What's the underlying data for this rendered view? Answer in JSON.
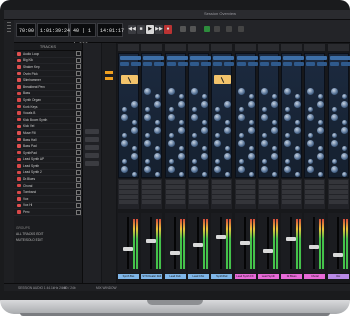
{
  "window": {
    "title": "Session Overview"
  },
  "transport": {
    "counter1": "70:00",
    "counter2": "1:01:39:24",
    "counter3": "40 | 1 | 282",
    "counter4": "14:01:17"
  },
  "sidebar": {
    "header": "TRACKS",
    "tracks": [
      {
        "name": "Audio Loop",
        "color": "#e05050"
      },
      {
        "name": "Big Kik",
        "color": "#e05050"
      },
      {
        "name": "Shaker Kep",
        "color": "#e05050"
      },
      {
        "name": "Ovrtn Pick",
        "color": "#e05050"
      },
      {
        "name": "Slimhammer",
        "color": "#e05050"
      },
      {
        "name": "Breakbeat Perc",
        "color": "#e05050"
      },
      {
        "name": "Bass",
        "color": "#d84848"
      },
      {
        "name": "Synth Organ",
        "color": "#d84848"
      },
      {
        "name": "Kork Keys",
        "color": "#d84848"
      },
      {
        "name": "Vocals B",
        "color": "#d84848"
      },
      {
        "name": "Kick Boom Synth",
        "color": "#d84848"
      },
      {
        "name": "Kick Vel",
        "color": "#e05050"
      },
      {
        "name": "Muse Fill",
        "color": "#e05050"
      },
      {
        "name": "Bass Hall",
        "color": "#e05050"
      },
      {
        "name": "Bass Pad",
        "color": "#e05050"
      },
      {
        "name": "SynthPad",
        "color": "#d84848"
      },
      {
        "name": "Lead Synth AP",
        "color": "#d84848"
      },
      {
        "name": "Lead Synth",
        "color": "#d84848"
      },
      {
        "name": "Lead Synth 2",
        "color": "#d84848"
      },
      {
        "name": "Dr.Blues",
        "color": "#d84848"
      },
      {
        "name": "Choral",
        "color": "#d84848"
      },
      {
        "name": "Tomband",
        "color": "#d84848"
      },
      {
        "name": "Vox",
        "color": "#e05050"
      },
      {
        "name": "Vox Hi",
        "color": "#e05050"
      },
      {
        "name": "Perc",
        "color": "#d84848"
      }
    ],
    "groups_header": "GROUPS",
    "groups": [
      "ALL TRACKS EDIT",
      "MUTE/SOLO EDIT"
    ]
  },
  "mixer": {
    "channels": [
      {
        "name": "Synth Bss",
        "color": "#7fb6e8"
      },
      {
        "name": "SYN Dealer Roll",
        "color": "#7fb6e8"
      },
      {
        "name": "Lead Dub",
        "color": "#7fb6e8"
      },
      {
        "name": "Lead Chic",
        "color": "#7fb6e8"
      },
      {
        "name": "SynthPad",
        "color": "#7fb6e8"
      },
      {
        "name": "Lead Synth FX",
        "color": "#e86ad8"
      },
      {
        "name": "Lead Synth",
        "color": "#e86ad8"
      },
      {
        "name": "Dr.Blues",
        "color": "#e86ad8"
      },
      {
        "name": "Choral",
        "color": "#e86ad8"
      },
      {
        "name": "Vox",
        "color": "#b98ae8"
      }
    ]
  },
  "footer": {
    "left": "SESSION AUDIO 1 44.1kHz 24bit",
    "mid": "80 / 24b",
    "right": "MIX WINDOW"
  }
}
